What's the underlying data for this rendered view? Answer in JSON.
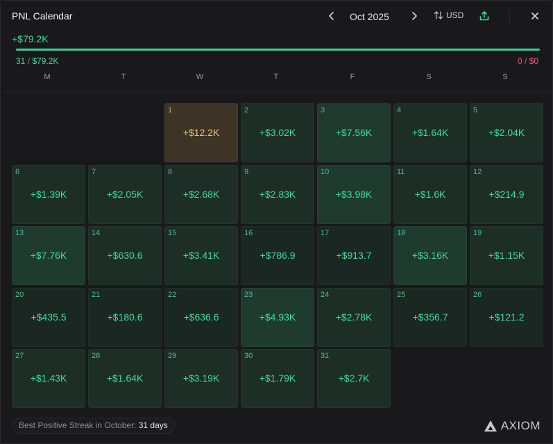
{
  "header": {
    "title": "PNL Calendar",
    "month": "Oct 2025",
    "currency": "USD"
  },
  "summary": {
    "total": "+$79.2K",
    "positive_days": "31",
    "positive_amount": "$79.2K",
    "negative_days": "0",
    "negative_amount": "$0",
    "positive_share": 1.0
  },
  "weekdays": [
    "M",
    "T",
    "W",
    "T",
    "F",
    "S",
    "S"
  ],
  "days": [
    {
      "day": "1",
      "pnl": "+$12.2K"
    },
    {
      "day": "2",
      "pnl": "+$3.02K"
    },
    {
      "day": "3",
      "pnl": "+$7.56K"
    },
    {
      "day": "4",
      "pnl": "+$1.64K"
    },
    {
      "day": "5",
      "pnl": "+$2.04K"
    },
    {
      "day": "6",
      "pnl": "+$1.39K"
    },
    {
      "day": "7",
      "pnl": "+$2.05K"
    },
    {
      "day": "8",
      "pnl": "+$2.68K"
    },
    {
      "day": "9",
      "pnl": "+$2.83K"
    },
    {
      "day": "10",
      "pnl": "+$3.98K"
    },
    {
      "day": "11",
      "pnl": "+$1.6K"
    },
    {
      "day": "12",
      "pnl": "+$214.9"
    },
    {
      "day": "13",
      "pnl": "+$7.76K"
    },
    {
      "day": "14",
      "pnl": "+$630.6"
    },
    {
      "day": "15",
      "pnl": "+$3.41K"
    },
    {
      "day": "16",
      "pnl": "+$786.9"
    },
    {
      "day": "17",
      "pnl": "+$913.7"
    },
    {
      "day": "18",
      "pnl": "+$3.16K"
    },
    {
      "day": "19",
      "pnl": "+$1.15K"
    },
    {
      "day": "20",
      "pnl": "+$435.5"
    },
    {
      "day": "21",
      "pnl": "+$180.6"
    },
    {
      "day": "22",
      "pnl": "+$636.6"
    },
    {
      "day": "23",
      "pnl": "+$4.93K"
    },
    {
      "day": "24",
      "pnl": "+$2.78K"
    },
    {
      "day": "25",
      "pnl": "+$356.7"
    },
    {
      "day": "26",
      "pnl": "+$121.2"
    },
    {
      "day": "27",
      "pnl": "+$1.43K"
    },
    {
      "day": "28",
      "pnl": "+$1.64K"
    },
    {
      "day": "29",
      "pnl": "+$3.19K"
    },
    {
      "day": "30",
      "pnl": "+$1.79K"
    },
    {
      "day": "31",
      "pnl": "+$2.7K"
    }
  ],
  "footer": {
    "streak_label": "Best Positive Streak in October:",
    "streak_value": "31 days",
    "brand": "AXIOM"
  },
  "colors": {
    "positive": "#3ddba0",
    "negative": "#ff4d7a",
    "highlight": "#f2c46b"
  }
}
